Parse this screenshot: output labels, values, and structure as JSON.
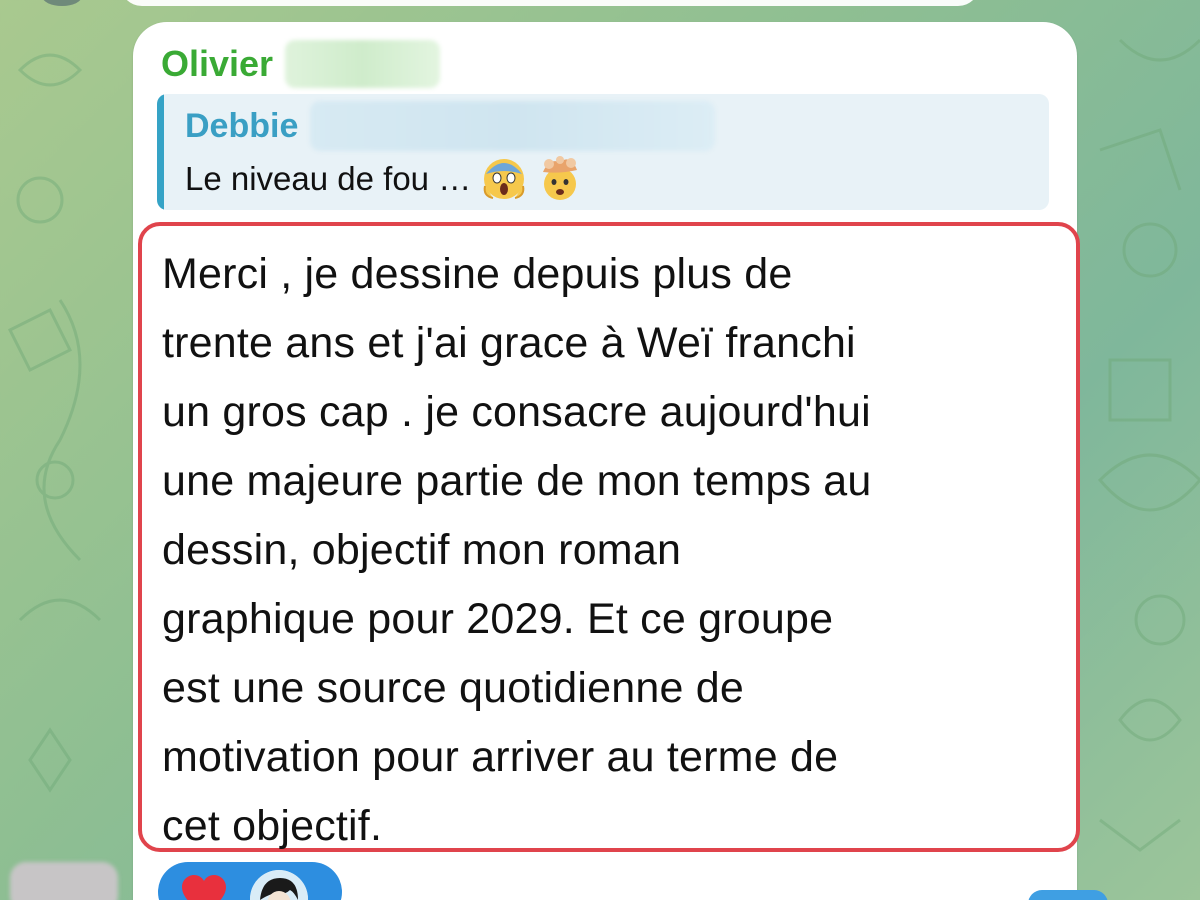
{
  "colors": {
    "sender_name": "#3aaa35",
    "quote_author": "#3a9fc4",
    "quote_bar": "#35a3c6",
    "highlight_border": "#e0444c",
    "reaction_pill": "#2d8ee0",
    "wallpaper": "#8fbf92"
  },
  "message": {
    "sender_name": "Olivier",
    "reply": {
      "author": "Debbie",
      "text": "Le niveau de fou …",
      "emojis": [
        "face-screaming-in-fear-emoji",
        "exploding-head-emoji"
      ]
    },
    "body": "Merci , je dessine depuis plus de\ntrente ans et j'ai grace à Weï franchi\nun gros cap . je consacre aujourd'hui\nune majeure partie de mon temps au\ndessin, objectif mon roman\ngraphique pour 2029. Et ce groupe\nest une source quotidienne de\nmotivation pour arriver au terme de\ncet objectif.",
    "reactions": [
      {
        "icon": "heart-icon",
        "reactor": "reactor-avatar"
      }
    ]
  }
}
